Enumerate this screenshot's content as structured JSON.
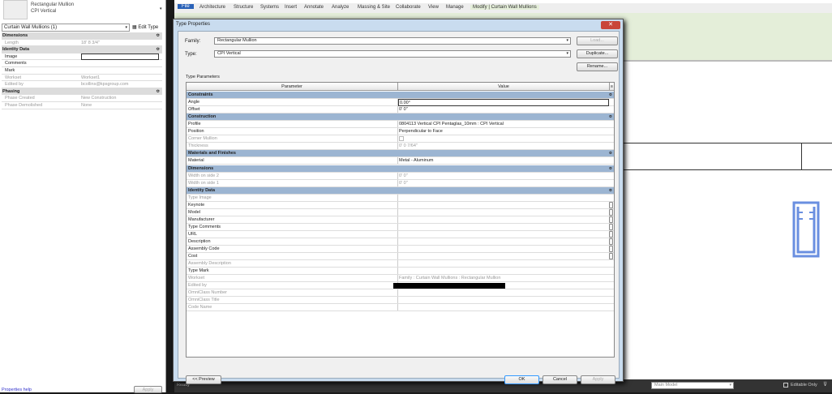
{
  "properties_panel": {
    "family": "Rectangular Mullion",
    "type": "CPI Vertical",
    "type_selector": "Curtain Wall Mullions (1)",
    "edit_type": "Edit Type",
    "rows": [
      {
        "k": "Dimensions",
        "g": true
      },
      {
        "k": "Length",
        "v": "18'  8 3/4\""
      },
      {
        "k": "Identity Data",
        "g": true
      },
      {
        "k": "Image",
        "v": "",
        "b": true
      },
      {
        "k": "Comments",
        "v": "",
        "b": true
      },
      {
        "k": "Mark",
        "v": "",
        "b": true
      },
      {
        "k": "Workset",
        "v": "Workset1"
      },
      {
        "k": "Edited by",
        "v": "bcollins@kpsgroup.com"
      },
      {
        "k": "Phasing",
        "g": true
      },
      {
        "k": "Phase Created",
        "v": "New Construction"
      },
      {
        "k": "Phase Demolished",
        "v": "None"
      }
    ],
    "help": "Properties help",
    "apply": "Apply"
  },
  "ribbon": {
    "tabs": [
      "File",
      "Architecture",
      "Structure",
      "Systems",
      "Insert",
      "Annotate",
      "Analyze",
      "Massing & Site",
      "Collaborate",
      "View",
      "Manage",
      "Modify | Curtain Wall Mullions"
    ]
  },
  "status": {
    "text": "Ready",
    "model": "Main Model",
    "editable_only": "Editable Only"
  },
  "dialog": {
    "title": "Type Properties",
    "family_label": "Family:",
    "family": "Rectangular Mullion",
    "type_label": "Type:",
    "type": "CPI Vertical",
    "load": "Load...",
    "duplicate": "Duplicate...",
    "rename": "Rename...",
    "type_params": "Type Parameters",
    "col_param": "Parameter",
    "col_value": "Value",
    "rows": [
      {
        "p": "Constraints",
        "g": true
      },
      {
        "p": "Angle",
        "v": "0.00°"
      },
      {
        "p": "Offset",
        "v": "0'  0\""
      },
      {
        "p": "Construction",
        "g": true
      },
      {
        "p": "Profile",
        "v": "0804113 Vertical CPI Pentaglas_10mm : CPI Vertical"
      },
      {
        "p": "Position",
        "v": "Perpendicular to Face"
      },
      {
        "p": "Corner Mullion",
        "v": "",
        "d": true,
        "cb": true
      },
      {
        "p": "Thickness",
        "v": "0'  0 7/64\"",
        "d": true
      },
      {
        "p": "Materials and Finishes",
        "g": true
      },
      {
        "p": "Material",
        "v": "Metal - Aluminum"
      },
      {
        "p": "Dimensions",
        "g": true
      },
      {
        "p": "Width on side 2",
        "v": "0'  0\"",
        "d": true
      },
      {
        "p": "Width on side 1",
        "v": "0'  0\"",
        "d": true
      },
      {
        "p": "Identity Data",
        "g": true
      },
      {
        "p": "Type Image",
        "v": "",
        "d": true
      },
      {
        "p": "Keynote",
        "v": "",
        "e": true
      },
      {
        "p": "Model",
        "v": "",
        "e": true
      },
      {
        "p": "Manufacturer",
        "v": "",
        "e": true
      },
      {
        "p": "Type Comments",
        "v": "",
        "e": true
      },
      {
        "p": "URL",
        "v": "",
        "e": true
      },
      {
        "p": "Description",
        "v": "",
        "e": true
      },
      {
        "p": "Assembly Code",
        "v": "",
        "e": true
      },
      {
        "p": "Cost",
        "v": "",
        "e": true
      },
      {
        "p": "Assembly Description",
        "v": "",
        "d": true
      },
      {
        "p": "Type Mark",
        "v": ""
      },
      {
        "p": "Workset",
        "v": "Family  : Curtain Wall Mullions : Rectangular Mullion",
        "d": true
      },
      {
        "p": "Edited by",
        "v": "",
        "d": true,
        "redact": true
      },
      {
        "p": "OmniClass Number",
        "v": "",
        "d": true
      },
      {
        "p": "OmniClass Title",
        "v": "",
        "d": true
      },
      {
        "p": "Code Name",
        "v": "",
        "d": true
      }
    ],
    "preview": "<< Preview",
    "ok": "OK",
    "cancel": "Cancel",
    "apply": "Apply"
  }
}
